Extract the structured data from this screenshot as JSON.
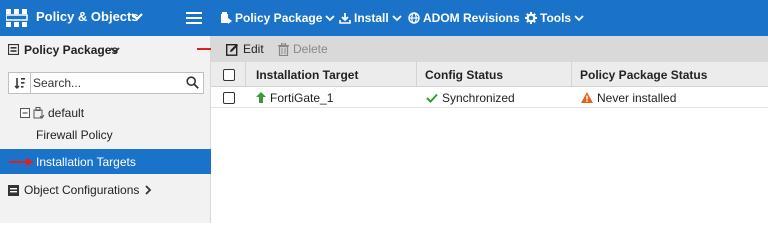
{
  "topbar": {
    "app_title": "Policy & Objects",
    "nav": [
      {
        "label": "Policy Package",
        "icon": "policy-package-icon"
      },
      {
        "label": "Install",
        "icon": "install-icon"
      },
      {
        "label": "ADOM Revisions",
        "icon": "globe-icon"
      },
      {
        "label": "Tools",
        "icon": "gear-icon"
      }
    ],
    "color": "#1a73c9"
  },
  "sidebar": {
    "header_label": "Policy Packages",
    "search_placeholder": "Search...",
    "tree_root_label": "default",
    "tree_child_label": "Firewall Policy",
    "selected_label": "Installation Targets",
    "object_configurations_label": "Object Configurations"
  },
  "toolbar": {
    "edit_label": "Edit",
    "delete_label": "Delete"
  },
  "table": {
    "columns": [
      "Installation Target",
      "Config Status",
      "Policy Package Status"
    ],
    "rows": [
      {
        "target": "FortiGate_1",
        "config_status": "Synchronized",
        "package_status": "Never installed"
      }
    ],
    "status_colors": {
      "ok": "#3a9a3a",
      "warning": "#e0641a",
      "device_up": "#3a9a3a"
    }
  },
  "annotation_color": "#e02020"
}
